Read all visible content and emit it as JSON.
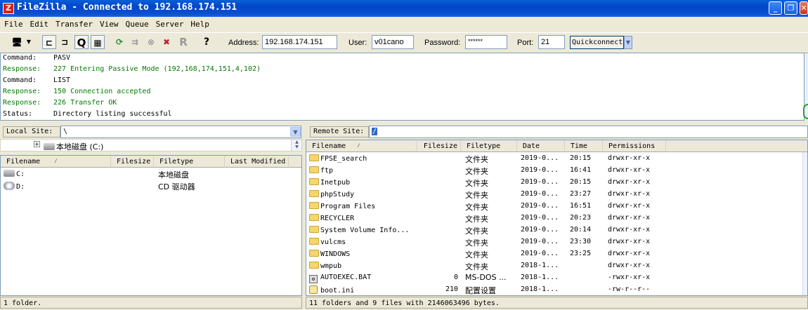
{
  "window": {
    "title": "FileZilla - Connected to 192.168.174.151",
    "app_icon": "Z"
  },
  "menu": [
    "File",
    "Edit",
    "Transfer",
    "View",
    "Queue",
    "Server",
    "Help"
  ],
  "quickconnect": {
    "address_label": "Address:",
    "address": "192.168.174.151",
    "user_label": "User:",
    "user": "v01cano",
    "password_label": "Password:",
    "password": "******",
    "port_label": "Port:",
    "port": "21",
    "button": "Quickconnect"
  },
  "log": [
    {
      "kind": "Command:",
      "text": "PASV",
      "color": "#000000"
    },
    {
      "kind": "Response:",
      "text": "227 Entering Passive Mode (192,168,174,151,4,102)",
      "color": "#007a00"
    },
    {
      "kind": "Command:",
      "text": "LIST",
      "color": "#000000"
    },
    {
      "kind": "Response:",
      "text": "150 Connection accepted",
      "color": "#007a00"
    },
    {
      "kind": "Response:",
      "text": "226 Transfer OK",
      "color": "#007a00"
    },
    {
      "kind": "Status:",
      "text": "Directory listing successful",
      "color": "#000000"
    }
  ],
  "local": {
    "site_label": "Local Site:",
    "path": "\\",
    "tree_item": "本地磁盘 (C:)",
    "columns": [
      "Filename",
      "Filesize",
      "Filetype",
      "Last Modified"
    ],
    "rows": [
      {
        "name": "C:",
        "type": "本地磁盘",
        "icon": "hard-drive-icon"
      },
      {
        "name": "D:",
        "type": "CD 驱动器",
        "icon": "cd-drive-icon"
      }
    ],
    "status": "1 folder."
  },
  "remote": {
    "site_label": "Remote Site:",
    "path": "/",
    "columns": [
      "Filename",
      "Filesize",
      "Filetype",
      "Date",
      "Time",
      "Permissions"
    ],
    "rows": [
      {
        "name": "FPSE_search",
        "size": "",
        "type": "文件夹",
        "date": "2019-0...",
        "time": "20:15",
        "perm": "drwxr-xr-x",
        "icon": "folder-icon"
      },
      {
        "name": "ftp",
        "size": "",
        "type": "文件夹",
        "date": "2019-0...",
        "time": "16:41",
        "perm": "drwxr-xr-x",
        "icon": "folder-icon"
      },
      {
        "name": "Inetpub",
        "size": "",
        "type": "文件夹",
        "date": "2019-0...",
        "time": "20:15",
        "perm": "drwxr-xr-x",
        "icon": "folder-icon"
      },
      {
        "name": "phpStudy",
        "size": "",
        "type": "文件夹",
        "date": "2019-0...",
        "time": "23:27",
        "perm": "drwxr-xr-x",
        "icon": "folder-icon"
      },
      {
        "name": "Program Files",
        "size": "",
        "type": "文件夹",
        "date": "2019-0...",
        "time": "16:51",
        "perm": "drwxr-xr-x",
        "icon": "folder-icon"
      },
      {
        "name": "RECYCLER",
        "size": "",
        "type": "文件夹",
        "date": "2019-0...",
        "time": "20:23",
        "perm": "drwxr-xr-x",
        "icon": "folder-icon"
      },
      {
        "name": "System Volume Info...",
        "size": "",
        "type": "文件夹",
        "date": "2019-0...",
        "time": "20:14",
        "perm": "drwxr-xr-x",
        "icon": "folder-icon"
      },
      {
        "name": "vulcms",
        "size": "",
        "type": "文件夹",
        "date": "2019-0...",
        "time": "23:30",
        "perm": "drwxr-xr-x",
        "icon": "folder-icon"
      },
      {
        "name": "WINDOWS",
        "size": "",
        "type": "文件夹",
        "date": "2019-0...",
        "time": "23:25",
        "perm": "drwxr-xr-x",
        "icon": "folder-icon"
      },
      {
        "name": "wmpub",
        "size": "",
        "type": "文件夹",
        "date": "2018-1...",
        "time": "",
        "perm": "drwxr-xr-x",
        "icon": "folder-icon"
      },
      {
        "name": "AUTOEXEC.BAT",
        "size": "0",
        "type": "MS-DOS ...",
        "date": "2018-1...",
        "time": "",
        "perm": "-rwxr-xr-x",
        "icon": "batch-file-icon"
      },
      {
        "name": "boot.ini",
        "size": "210",
        "type": "配置设置",
        "date": "2018-1...",
        "time": "",
        "perm": "-rw-r--r--",
        "icon": "ini-file-icon"
      }
    ],
    "status": "11 folders and 9 files with 2146063496 bytes."
  }
}
